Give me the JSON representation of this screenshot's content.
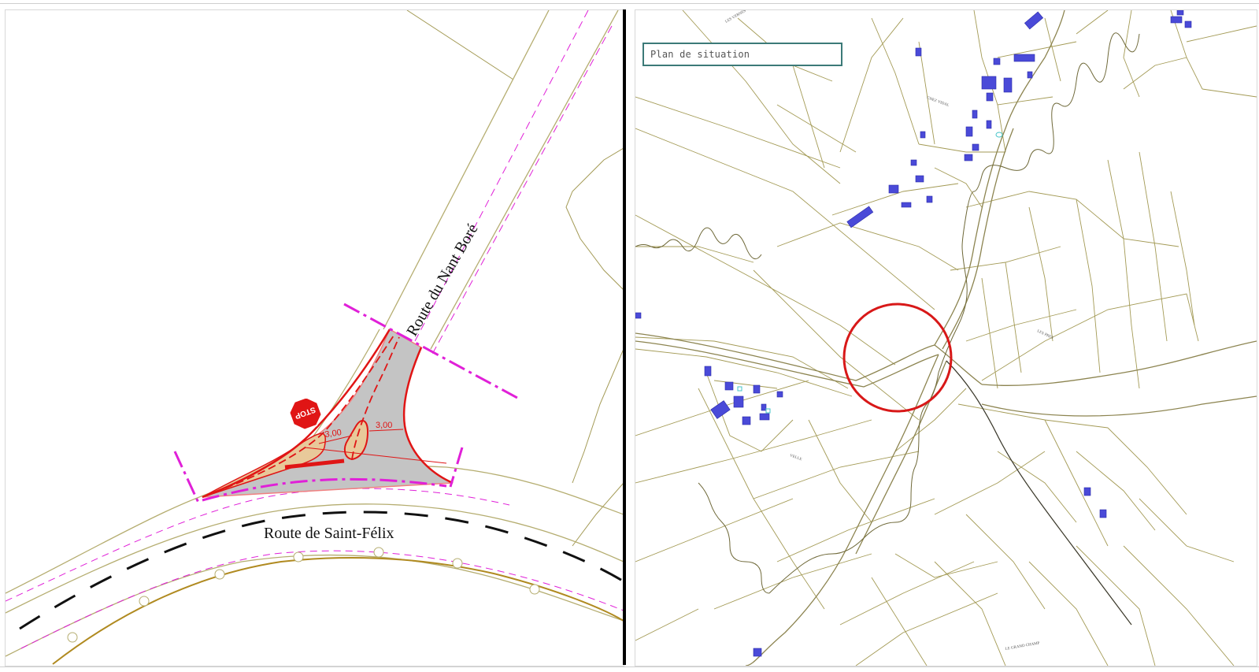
{
  "left_panel": {
    "road_north_label": "Route du Nant Boré",
    "road_south_label": "Route de Saint-Félix",
    "stop_sign_text": "STOP",
    "dimension_1": "3,00",
    "dimension_2": "3,00"
  },
  "right_panel": {
    "title": "Plan de situation",
    "place_labels": [
      "LES VERNES",
      "CHEZ VIDAL",
      "LES PRES",
      "VELLE",
      "LE GRAND CHAMP"
    ]
  },
  "colors": {
    "parcel_line": "#a39a55",
    "road_edge": "#b5ad70",
    "magenta": "#e020d8",
    "red": "#e01515",
    "island_fill": "#e8c99a",
    "paved_fill": "#c4c4c4",
    "building": "#4a4ad8",
    "circle": "#d81818",
    "embankment": "#b08a20"
  }
}
